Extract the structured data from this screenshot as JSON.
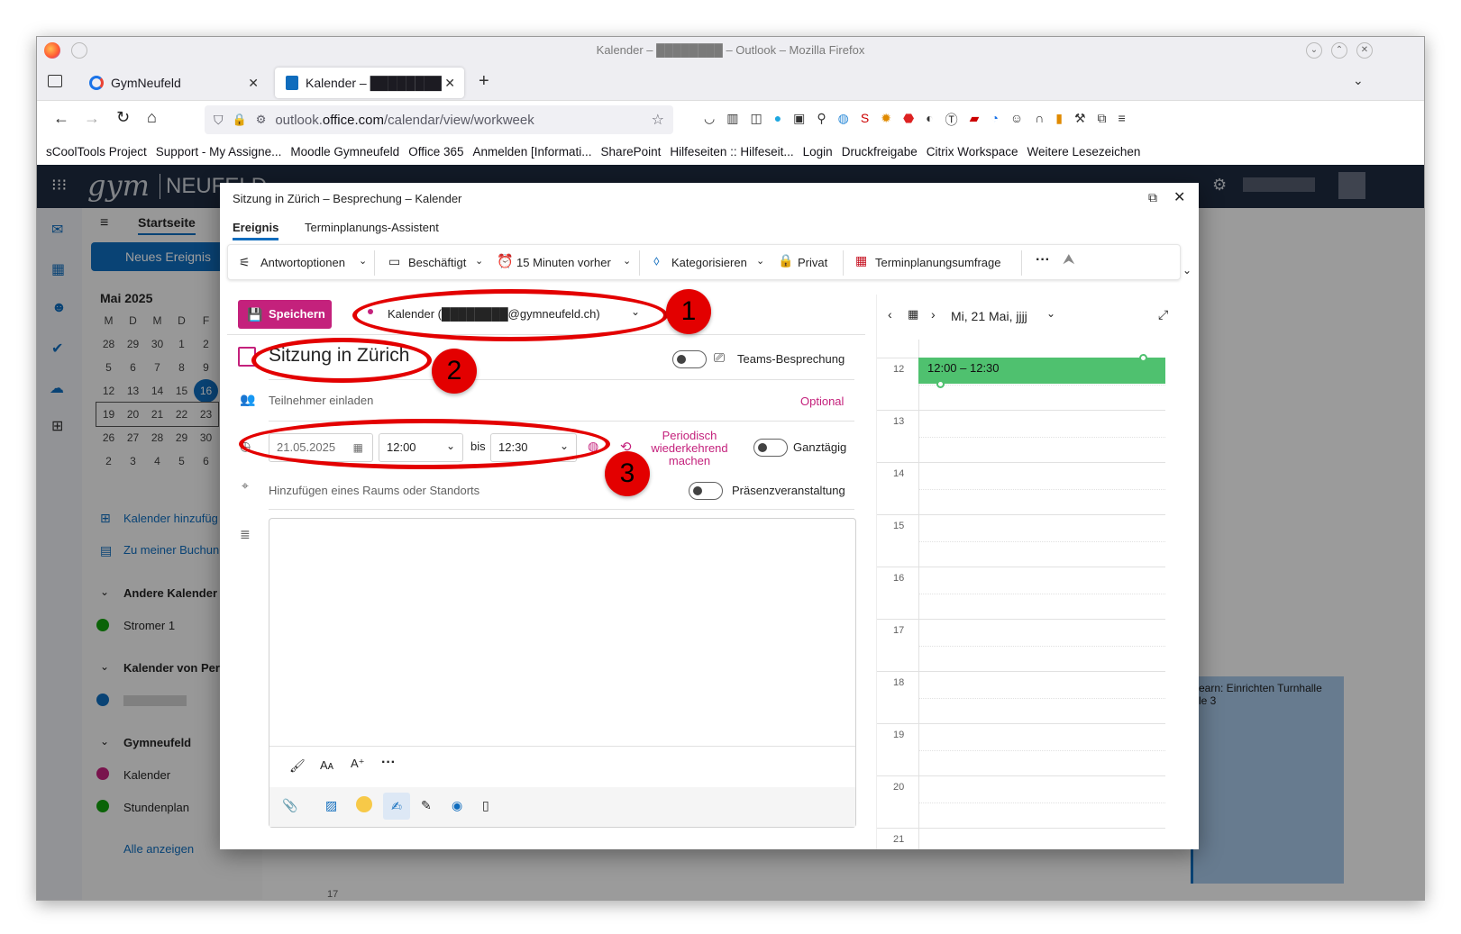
{
  "browser": {
    "window_title": "Kalender – ████████ – Outlook – Mozilla Firefox",
    "tabs": [
      {
        "label": "GymNeufeld",
        "close": "✕"
      },
      {
        "label": "Kalender – ████████",
        "close": "✕"
      }
    ],
    "new_tab": "+",
    "url_prefix": "outlook.",
    "url_domain": "office.com",
    "url_path": "/calendar/view/workweek",
    "bookmarks": [
      "sCoolTools Project",
      "Support - My Assigne...",
      "Moodle Gymneufeld",
      "Office 365",
      "Anmelden [Informati...",
      "SharePoint",
      "Hilfeseiten :: Hilfeseit...",
      "Login",
      "Druckfreigabe",
      "Citrix Workspace",
      "Weitere Lesezeichen"
    ]
  },
  "owa": {
    "brand_a": "gym",
    "brand_b": "NEUFELD",
    "tab_home": "Startseite",
    "new_event": "Neues Ereignis",
    "month": "Mai 2025",
    "weekdays": [
      "M",
      "D",
      "M",
      "D",
      "F"
    ],
    "weeks": [
      [
        "28",
        "29",
        "30",
        "1",
        "2"
      ],
      [
        "5",
        "6",
        "7",
        "8",
        "9"
      ],
      [
        "12",
        "13",
        "14",
        "15",
        "16"
      ],
      [
        "19",
        "20",
        "21",
        "22",
        "23"
      ],
      [
        "26",
        "27",
        "28",
        "29",
        "30"
      ],
      [
        "2",
        "3",
        "4",
        "5",
        "6"
      ]
    ],
    "add_calendar": "Kalender hinzufüg",
    "booking": "Zu meiner Buchun",
    "other_calendars": "Andere Kalender",
    "stromer": "Stromer 1",
    "cal_from_person": "Kalender von Per",
    "group_gym": "Gymneufeld",
    "kalender": "Kalender",
    "stundenplan": "Stundenplan",
    "show_all": "Alle anzeigen",
    "bg_event_1": "earn: Einrichten Turnhalle",
    "bg_event_2": "le 3",
    "bg_hour": "17"
  },
  "dialog": {
    "title": "Sitzung in Zürich – Besprechung – Kalender",
    "tabs": [
      "Ereignis",
      "Terminplanungs-Assistent"
    ],
    "toolbar": {
      "response": "Antwortoptionen",
      "busy": "Beschäftigt",
      "reminder": "15 Minuten vorher",
      "categorize": "Kategorisieren",
      "private": "Privat",
      "poll": "Terminplanungsumfrage",
      "more": "···"
    },
    "save": "Speichern",
    "calendar_select": "Kalender (████████@gymneufeld.ch)",
    "subject": "Sitzung in Zürich",
    "teams": "Teams-Besprechung",
    "invite": "Teilnehmer einladen",
    "optional": "Optional",
    "date": "21.05.2025",
    "start": "12:00",
    "to": "bis",
    "end": "12:30",
    "recurring": "Periodisch wiederkehrend machen",
    "allday": "Ganztägig",
    "location": "Hinzufügen eines Raums oder Standorts",
    "inperson": "Präsenzveranstaltung",
    "fmt_more": "···",
    "day_header": "Mi, 21 Mai, jjjj",
    "event_time": "12:00 – 12:30",
    "hours": [
      "12",
      "13",
      "14",
      "15",
      "16",
      "17",
      "18",
      "19",
      "20",
      "21"
    ]
  },
  "annotations": [
    "1",
    "2",
    "3"
  ],
  "colors": {
    "accent": "#c4217c",
    "event": "#4fc16f",
    "annotation": "#e30000",
    "header": "#1e2a3f"
  }
}
